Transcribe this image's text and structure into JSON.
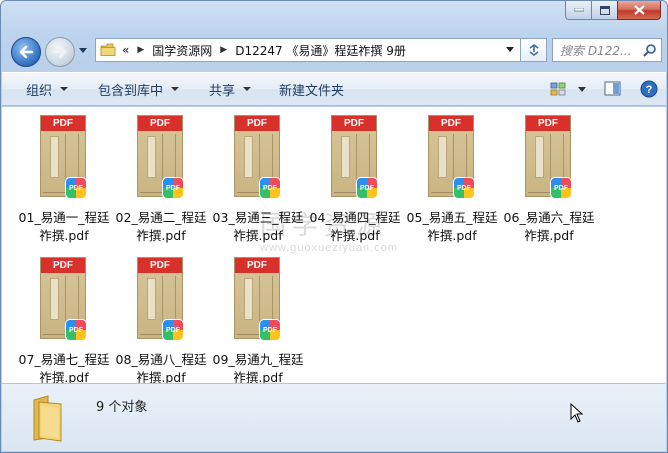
{
  "window": {
    "caption_buttons": [
      "minimize",
      "maximize",
      "close"
    ]
  },
  "address_bar": {
    "prefix": "«",
    "crumbs": [
      "国学资源网",
      "D12247 《易通》程廷祚撰 9册"
    ],
    "search_placeholder": "搜索 D122..."
  },
  "toolbar": {
    "organize": "组织",
    "include_in_library": "包含到库中",
    "share": "共享",
    "new_folder": "新建文件夹"
  },
  "files": [
    {
      "line1": "01_易通一_程廷",
      "line2": "祚撰.pdf"
    },
    {
      "line1": "02_易通二_程廷",
      "line2": "祚撰.pdf"
    },
    {
      "line1": "03_易通三_程廷",
      "line2": "祚撰.pdf"
    },
    {
      "line1": "04_易通四_程廷",
      "line2": "祚撰.pdf"
    },
    {
      "line1": "05_易通五_程廷",
      "line2": "祚撰.pdf"
    },
    {
      "line1": "06_易通六_程廷",
      "line2": "祚撰.pdf"
    },
    {
      "line1": "07_易通七_程廷",
      "line2": "祚撰.pdf"
    },
    {
      "line1": "08_易通八_程廷",
      "line2": "祚撰.pdf"
    },
    {
      "line1": "09_易通九_程廷",
      "line2": "祚撰.pdf"
    }
  ],
  "thumbnail": {
    "band_text": "PDF",
    "badge_text": "PDF"
  },
  "watermark": {
    "big": "国学资源",
    "url": "www.guoxueziyuan.com"
  },
  "details": {
    "count": "9 个对象"
  },
  "colors": {
    "pdf_band": "#d8302a",
    "accent": "#2f6fc1"
  }
}
